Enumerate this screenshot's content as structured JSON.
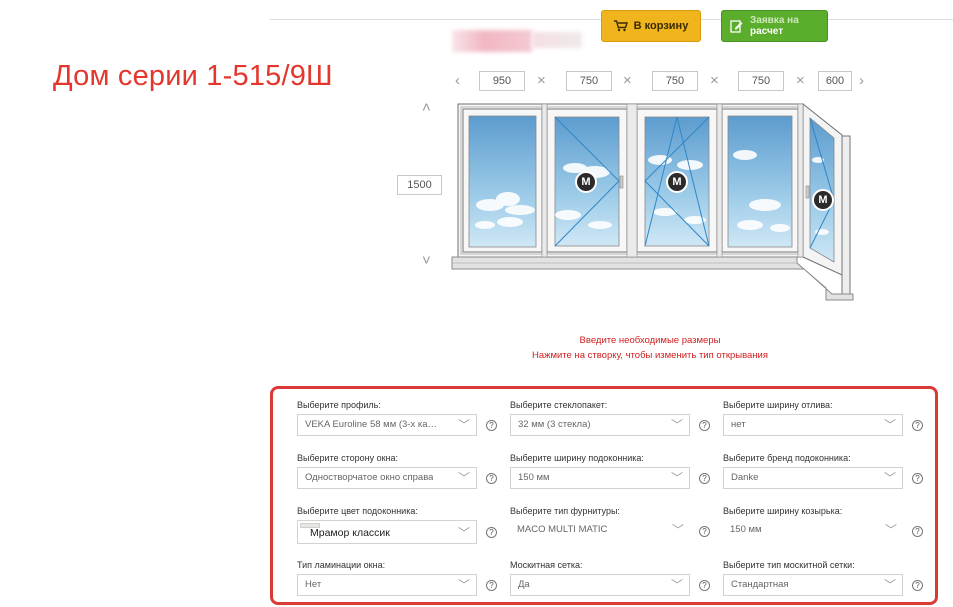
{
  "header": {
    "heading": "Дом серии 1-515/9Ш",
    "cart_button": "В корзину",
    "calc_button_top": "Заявка на",
    "calc_button_bottom": "расчет"
  },
  "dimensions": {
    "widths": [
      "950",
      "750",
      "750",
      "750",
      "600"
    ],
    "height": "1500",
    "prev_arrow": "‹",
    "next_arrow": "›",
    "up_arrow": "˄",
    "down_arrow": "˅",
    "separator": "×"
  },
  "sash_marker": "M",
  "messages": {
    "line1": "Введите необходимые размеры",
    "line2": "Нажмите на створку, чтобы изменить тип открывания"
  },
  "config": {
    "profile": {
      "label": "Выберите профиль:",
      "value": "VEKA Euroline 58 мм (3-х ка…"
    },
    "glass": {
      "label": "Выберите стеклопакет:",
      "value": "32 мм (3 стекла)"
    },
    "drip_width": {
      "label": "Выберите ширину отлива:",
      "value": "нет"
    },
    "window_side": {
      "label": "Выберите сторону окна:",
      "value": "Одностворчатое окно справа"
    },
    "sill_width": {
      "label": "Выберите ширину подоконника:",
      "value": "150 мм"
    },
    "sill_brand": {
      "label": "Выберите бренд подоконника:",
      "value": "Danke"
    },
    "sill_color": {
      "label": "Выберите цвет подоконника:",
      "value": "Мрамор классик"
    },
    "hardware": {
      "label": "Выберите тип фурнитуры:",
      "value": "MACO MULTI MATIC"
    },
    "visor_width": {
      "label": "Выберите ширину козырька:",
      "value": "150 мм"
    },
    "lamination": {
      "label": "Тип ламинации окна:",
      "value": "Нет"
    },
    "mosquito": {
      "label": "Москитная сетка:",
      "value": "Да"
    },
    "mosquito_type": {
      "label": "Выберите тип москитной сетки:",
      "value": "Стандартная"
    },
    "help_glyph": "?"
  }
}
